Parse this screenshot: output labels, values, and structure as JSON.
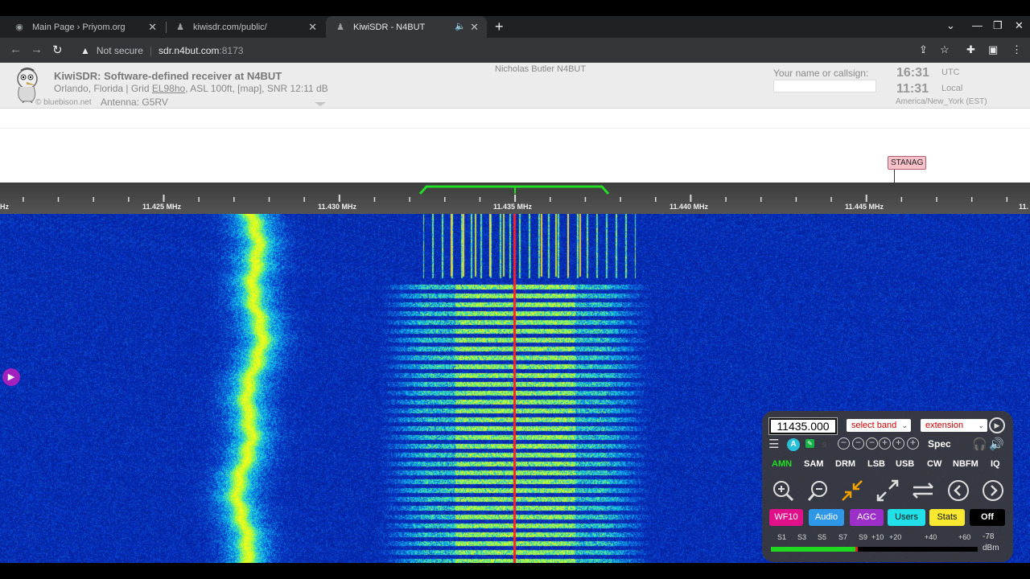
{
  "browser": {
    "tabs": [
      {
        "title": "Main Page › Priyom.org",
        "active": false
      },
      {
        "title": "kiwisdr.com/public/",
        "active": false
      },
      {
        "title": "KiwiSDR - N4BUT",
        "active": true
      }
    ],
    "address": {
      "security": "Not secure",
      "host": "sdr.n4but.com",
      "port": ":8173"
    }
  },
  "header": {
    "title": "KiwiSDR: Software-defined receiver at N4BUT",
    "loc_prefix": "Orlando, Florida | Grid ",
    "grid": "EL98ho",
    "loc_mid": ", ASL 100ft, ",
    "map_link": "[map]",
    "snr": ", SNR 12:11 dB",
    "credit": "© bluebison.net",
    "antenna": "Antenna: G5RV",
    "owner": "Nicholas Butler N4BUT",
    "callsign_label": "Your name or callsign:",
    "callsign_value": "",
    "utc_time": "16:31",
    "utc_label": "UTC",
    "local_time": "11:31",
    "local_label": "Local",
    "timezone": "America/New_York (EST)"
  },
  "labels": {
    "stanag": "STANAG"
  },
  "scale": {
    "left_fragment": "Hz",
    "ticks": [
      "11.425 MHz",
      "11.430 MHz",
      "11.435 MHz",
      "11.440 MHz",
      "11.445 MHz"
    ],
    "right_fragment": "11."
  },
  "panel": {
    "frequency": "11435.000",
    "band_select": "select band",
    "extension_select": "extension",
    "auto_badge": "A",
    "zoom_level": "9",
    "spec": "Spec",
    "modes": [
      "AMN",
      "SAM",
      "DRM",
      "LSB",
      "USB",
      "CW",
      "NBFM",
      "IQ"
    ],
    "selected_mode": "AMN",
    "buttons": {
      "wf": "WF10",
      "audio": "Audio",
      "agc": "AGC",
      "users": "Users",
      "stats": "Stats",
      "off": "Off"
    },
    "smeter": {
      "labels": [
        "S1",
        "S3",
        "S5",
        "S7",
        "S9",
        "+10",
        "+20",
        "+40",
        "+60"
      ],
      "value": "-78",
      "unit": "dBm",
      "level": 0.41
    }
  },
  "colors": {
    "passband": "#22dd22",
    "tuning_line": "#ff2020",
    "waterfall_bg": "#0a1aa8"
  }
}
